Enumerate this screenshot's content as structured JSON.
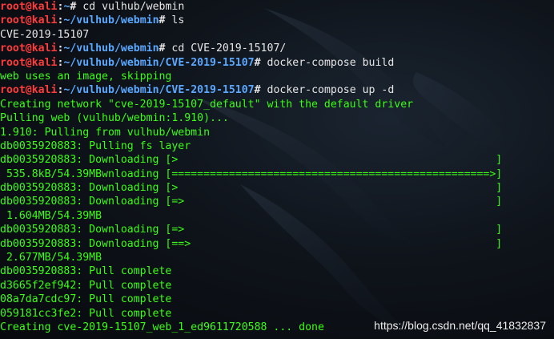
{
  "terminal": {
    "colors": {
      "background": "#0b0f14",
      "prompt_user": "#ff3b3b",
      "prompt_path": "#5aa8ff",
      "command": "#e6e6e6",
      "output": "#39ff14"
    },
    "lines": [
      {
        "type": "prompt",
        "user": "root@kali",
        "sep": ":",
        "path": "~",
        "tail": "# ",
        "cmd": "cd vulhub/webmin"
      },
      {
        "type": "prompt",
        "user": "root@kali",
        "sep": ":",
        "path": "~/vulhub/webmin",
        "tail": "# ",
        "cmd": "ls"
      },
      {
        "type": "plain",
        "text": "CVE-2019-15107"
      },
      {
        "type": "prompt",
        "user": "root@kali",
        "sep": ":",
        "path": "~/vulhub/webmin",
        "tail": "# ",
        "cmd": "cd CVE-2019-15107/"
      },
      {
        "type": "prompt",
        "user": "root@kali",
        "sep": ":",
        "path": "~/vulhub/webmin/CVE-2019-15107",
        "tail": "# ",
        "cmd": "docker-compose build"
      },
      {
        "type": "output",
        "text": "web uses an image, skipping"
      },
      {
        "type": "prompt",
        "user": "root@kali",
        "sep": ":",
        "path": "~/vulhub/webmin/CVE-2019-15107",
        "tail": "# ",
        "cmd": "docker-compose up -d"
      },
      {
        "type": "output",
        "text": "Creating network \"cve-2019-15107_default\" with the default driver"
      },
      {
        "type": "output",
        "text": "Pulling web (vulhub/webmin:1.910)..."
      },
      {
        "type": "output",
        "text": "1.910: Pulling from vulhub/webmin"
      },
      {
        "type": "output",
        "text": "db0035920883: Pulling fs layer"
      },
      {
        "type": "output",
        "text": "db0035920883: Downloading [>                                                  ]"
      },
      {
        "type": "output",
        "text": " 535.8kB/54.39MBwnloading [==================================================>]"
      },
      {
        "type": "output",
        "text": "db0035920883: Downloading [>                                                  ]"
      },
      {
        "type": "output",
        "text": "db0035920883: Downloading [=>                                                 ]"
      },
      {
        "type": "output",
        "text": " 1.604MB/54.39MB"
      },
      {
        "type": "output",
        "text": "db0035920883: Downloading [=>                                                 ]"
      },
      {
        "type": "output",
        "text": "db0035920883: Downloading [==>                                                ]"
      },
      {
        "type": "output",
        "text": " 2.677MB/54.39MB"
      },
      {
        "type": "output",
        "text": "db0035920883: Pull complete"
      },
      {
        "type": "output",
        "text": "d3665f2ef942: Pull complete"
      },
      {
        "type": "output",
        "text": "08a7da7cdc97: Pull complete"
      },
      {
        "type": "output",
        "text": "059181cc3fe2: Pull complete"
      },
      {
        "type": "output",
        "text": "Creating cve-2019-15107_web_1_ed9611720588 ... done"
      }
    ]
  },
  "watermark": "https://blog.csdn.net/qq_41832837"
}
